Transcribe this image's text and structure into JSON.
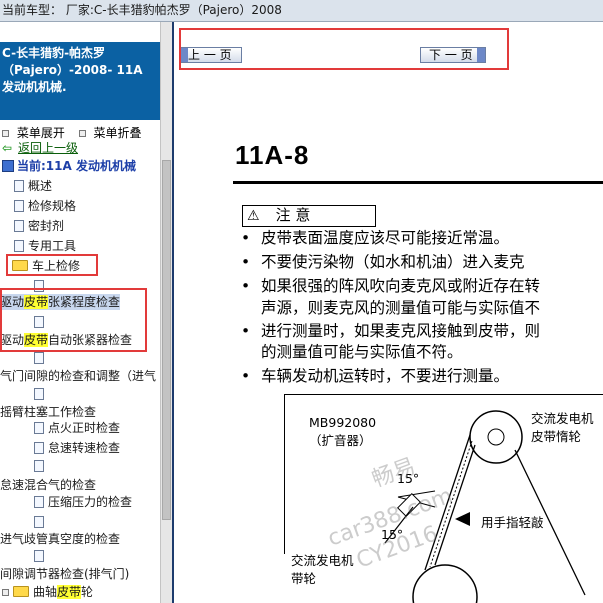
{
  "topbar": {
    "title": "当前车型： 厂家:C-长丰猎豹帕杰罗（Pajero）2008"
  },
  "sidebar": {
    "header_lines": [
      "C-长丰猎豹-帕杰罗",
      "（Pajero）-2008- 11A",
      "发动机机械."
    ],
    "expand_label": "菜单展开",
    "collapse_label": "菜单折叠",
    "back_label": "返回上一级",
    "current_label": "当前:11A 发动机机械",
    "items": {
      "overview": "概述",
      "specs": "检修规格",
      "sealant": "密封剂",
      "tools": "专用工具",
      "onvehicle": "车上检修",
      "belt_tension_pre": "驱动",
      "belt_tension_hl": "皮带",
      "belt_tension_post": "张紧程度检查",
      "belt_auto_pre": "驱动",
      "belt_auto_hl": "皮带",
      "belt_auto_post": "自动张紧器检查",
      "valve_clearance": "气门间隙的检查和调整（进气",
      "rocker": "摇臂柱塞工作检查",
      "ignition_timing": "点火正时检查",
      "idle_speed": "怠速转速检查",
      "idle_mixture": "怠速混合气的检查",
      "compression": "压缩压力的检查",
      "manifold_vacuum": "进气歧管真空度的检查",
      "lash_adjuster": "间隙调节器检查(排气门)",
      "crank_pre": "曲轴",
      "crank_hl": "皮带",
      "crank_post": "轮"
    }
  },
  "nav": {
    "prev_label": "上 一 页",
    "next_label": "下 一 页"
  },
  "page": {
    "number": "11A-8",
    "caution_label": "注  意",
    "bullets": [
      "皮带表面温度应该尽可能接近常温。",
      "不要使污染物（如水和机油）进入麦克",
      "如果很强的阵风吹向麦克风或附近存在转",
      "声源，则麦克风的测量值可能与实际值不",
      "进行测量时，如果麦克风接触到皮带，则",
      "的测量值可能与实际值不符。",
      "车辆发动机运转时，不要进行测量。"
    ],
    "figure": {
      "part_no": "MB992080",
      "amplifier": "（扩音器）",
      "angle_top": "15°",
      "angle_bottom": "15°",
      "alternator_pulley": "交流发电机",
      "alternator_belt": "皮带惰轮",
      "tap_note": "用手指轻敲",
      "alt_label_1": "交流发电机",
      "alt_label_2": "带轮",
      "watermark_1": "畅易",
      "watermark_2": "car388.com",
      "watermark_3": "CY2016"
    }
  },
  "colors": {
    "header_bg": "#0b61a3",
    "highlight": "#ffff33",
    "annotation": "#e23a3a"
  }
}
